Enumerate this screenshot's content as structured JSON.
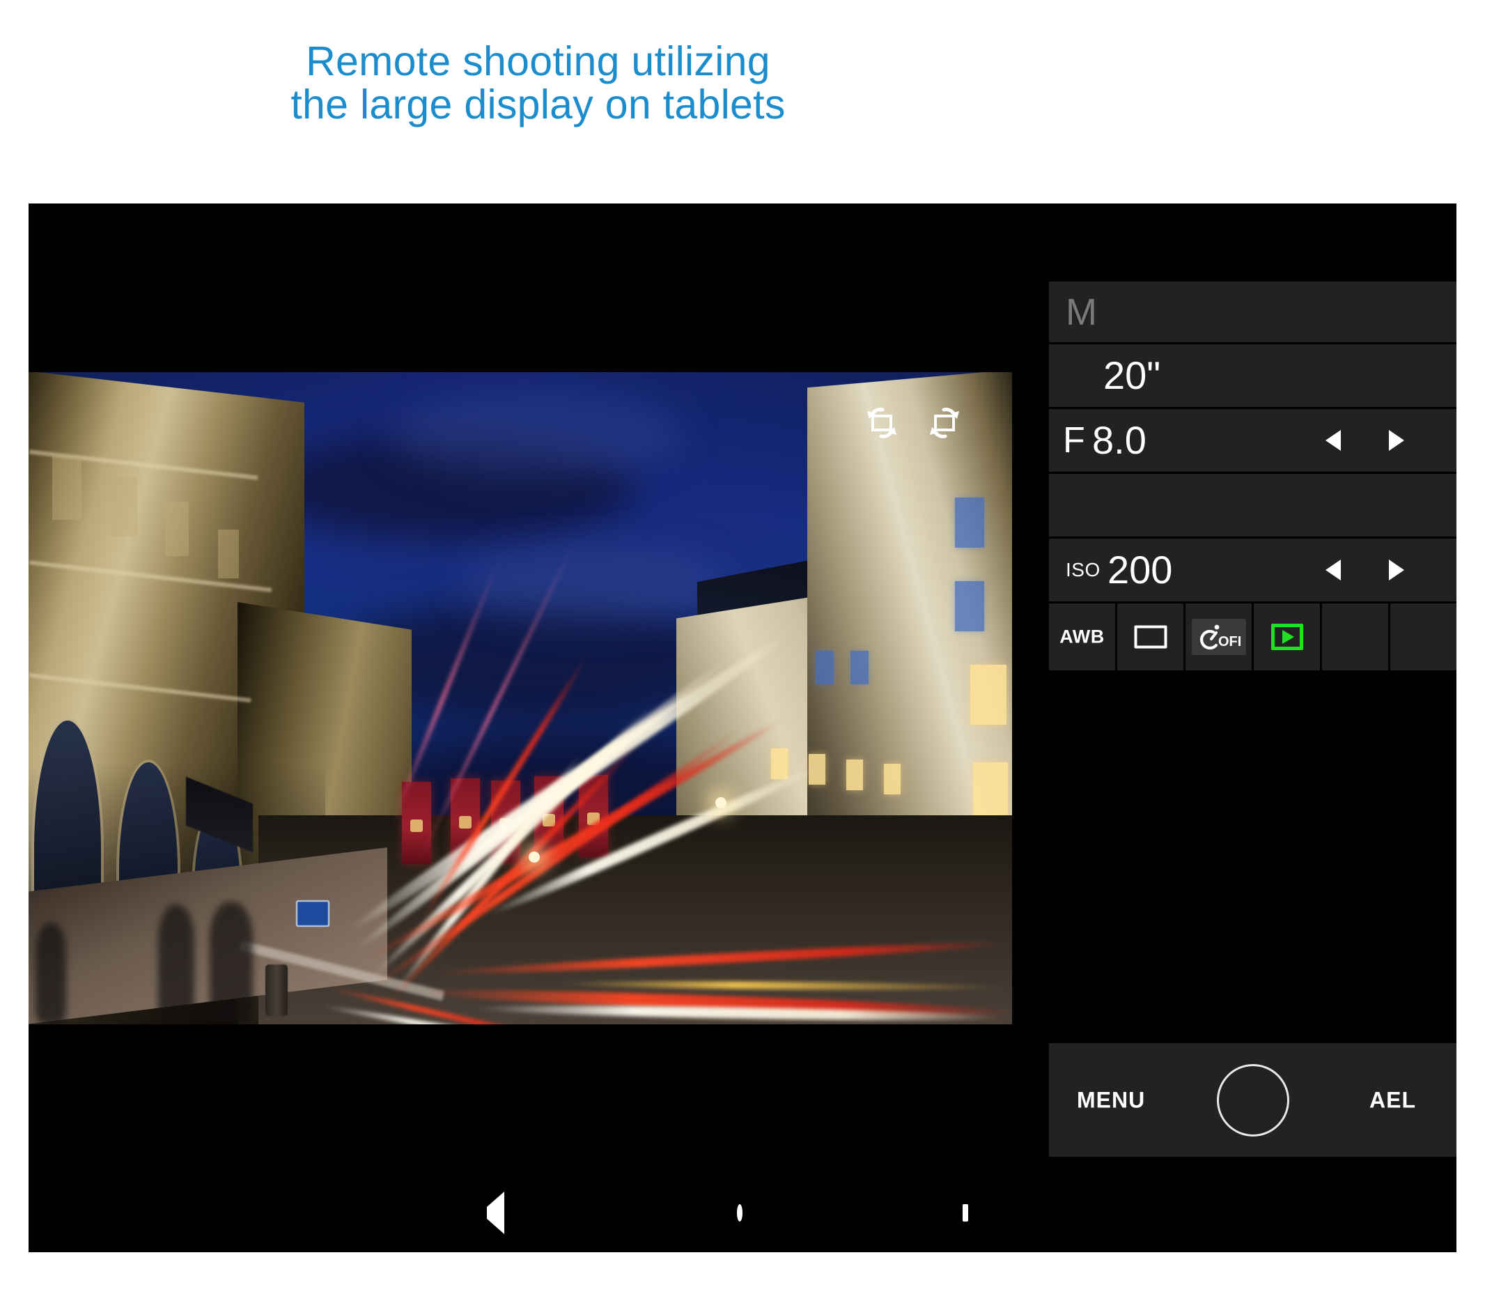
{
  "headline": {
    "line1": "Remote shooting utilizing",
    "line2": "the large display on tablets",
    "color": "#1b8ccc"
  },
  "viewfinder": {
    "top_icons": [
      {
        "name": "rotate-ccw-icon",
        "label": "rotate counter-clockwise"
      },
      {
        "name": "rotate-cw-icon",
        "label": "rotate clockwise"
      }
    ],
    "white_balance_badge": "AWB",
    "flash_icon": "flash-icon",
    "scene_description": "Night city street long-exposure with light trails"
  },
  "panel": {
    "mode": "M",
    "shutter_speed": "20\"",
    "aperture_prefix": "F",
    "aperture_value": "8.0",
    "iso_prefix": "ISO",
    "iso_value": "200",
    "arrow_left": "◀",
    "arrow_right": "▶",
    "icon_row": [
      {
        "name": "awb-cell",
        "label": "AWB",
        "type": "text",
        "selected": false
      },
      {
        "name": "aspect-ratio-cell",
        "label": "",
        "type": "rect",
        "selected": false
      },
      {
        "name": "self-timer-cell",
        "label": "OFF",
        "type": "timer",
        "selected": true
      },
      {
        "name": "record-cell",
        "label": "",
        "type": "play",
        "selected": false,
        "color": "#1fe11f"
      },
      {
        "name": "empty-cell-1",
        "label": "",
        "type": "empty",
        "selected": false
      },
      {
        "name": "empty-cell-2",
        "label": "",
        "type": "empty",
        "selected": false
      }
    ]
  },
  "bottom_bar": {
    "menu_label": "MENU",
    "ael_label": "AEL",
    "shutter_label": ""
  },
  "navbar": {
    "back": "back-button",
    "home": "home-button",
    "recents": "recents-button"
  }
}
